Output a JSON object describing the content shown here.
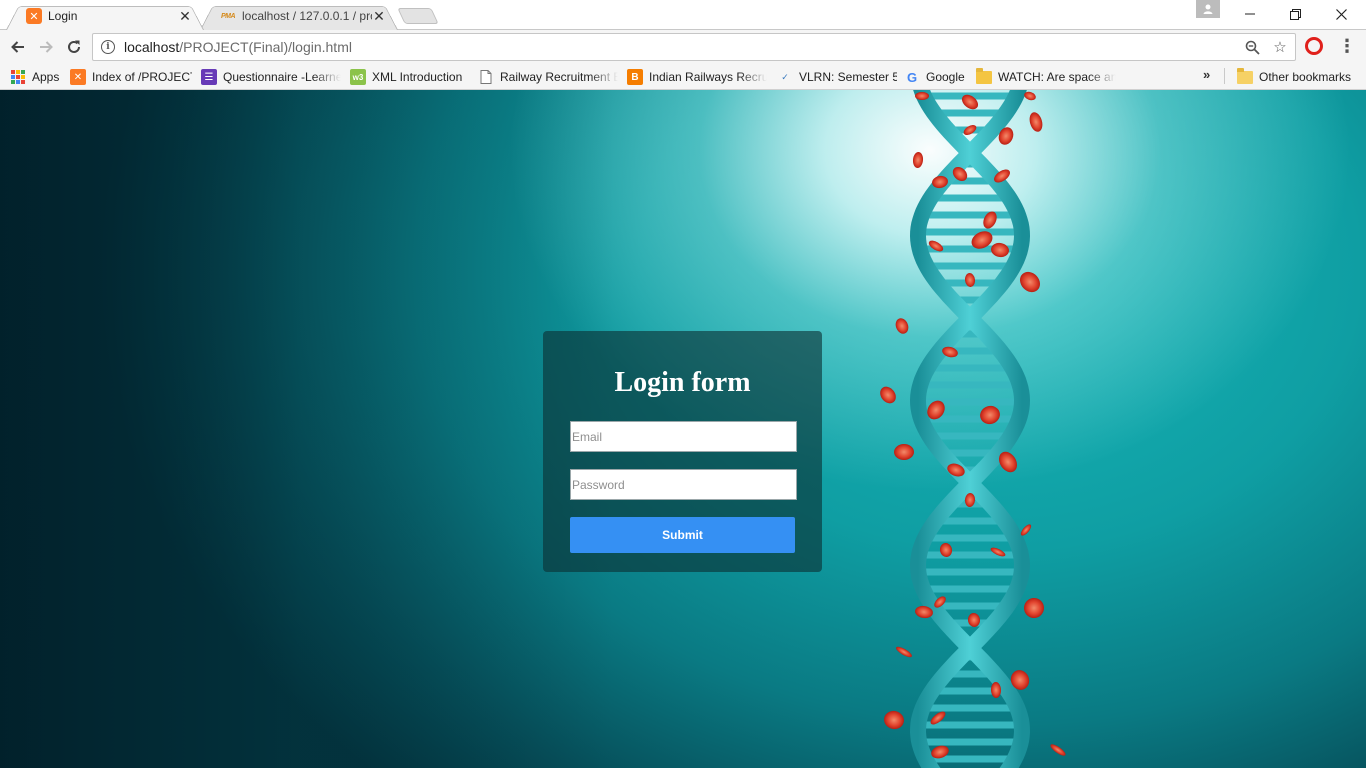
{
  "browser": {
    "tabs": [
      {
        "title": "Login",
        "favicon": "xampp-icon",
        "active": true
      },
      {
        "title": "localhost / 127.0.0.1 / pro",
        "favicon": "phpmyadmin-icon",
        "active": false
      }
    ],
    "url_host": "localhost",
    "url_path": "/PROJECT(Final)/login.html",
    "bookmarks": [
      {
        "label": "Apps",
        "icon": "apps-grid-icon"
      },
      {
        "label": "Index of /PROJECT",
        "icon": "xampp-icon"
      },
      {
        "label": "Questionnaire -Learne",
        "icon": "forms-icon"
      },
      {
        "label": "XML Introduction",
        "icon": "w3schools-icon"
      },
      {
        "label": "Railway Recruitment E",
        "icon": "page-icon"
      },
      {
        "label": "Indian Railways Recru",
        "icon": "blogger-icon"
      },
      {
        "label": "VLRN: Semester 5",
        "icon": "vlrn-icon"
      },
      {
        "label": "Google",
        "icon": "google-icon"
      },
      {
        "label": "WATCH: Are space an",
        "icon": "folder-link-icon"
      }
    ],
    "other_bookmarks": "Other bookmarks"
  },
  "page": {
    "form": {
      "title": "Login form",
      "email_placeholder": "Email",
      "password_placeholder": "Password",
      "submit_label": "Submit"
    }
  },
  "colors": {
    "accent_button": "#3590f3",
    "background_teal": "#0f9ea3",
    "card_background": "#0c3034"
  }
}
